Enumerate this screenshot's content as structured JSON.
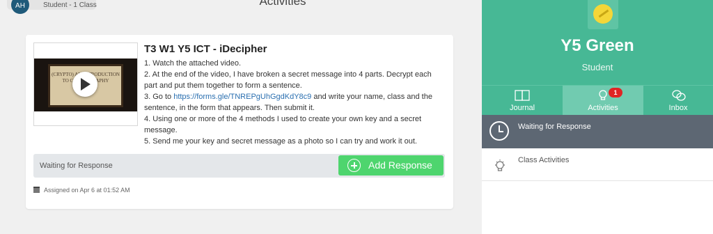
{
  "header": {
    "avatar_initials": "AH",
    "subtitle": "Student - 1 Class",
    "title": "Activities"
  },
  "activity": {
    "title": "T3 W1 Y5 ICT - iDecipher",
    "video_caption": "(CRYPTO) AN INTRODUCTION TO CRYPTOGRAPHY",
    "lines": {
      "l1": "1. Watch the attached video.",
      "l2": "2. At the end of the video, I have broken a secret message into 4 parts. Decrypt each part and put them together to form a sentence.",
      "l3_pre": "3. Go to ",
      "l3_link": "https://forms.gle/TNREPgUhGgdKdY8c9",
      "l3_post": " and write your name, class and the sentence, in the form that appears. Then submit it.",
      "l4": "4. Using one or more of the 4 methods I used to create your own key and a secret message.",
      "l5": "5. Send me your key and secret message as a photo so I can try and work it out."
    },
    "response_status": "Waiting for Response",
    "add_response_label": "Add Response",
    "assigned": "Assigned on Apr 6 at 01:52 AM"
  },
  "sidebar": {
    "class_name": "Y5 Green",
    "role": "Student",
    "tabs": {
      "journal": "Journal",
      "activities": "Activities",
      "activities_badge": "1",
      "inbox": "Inbox"
    },
    "filters": {
      "waiting": "Waiting for Response",
      "class_activities": "Class Activities"
    }
  },
  "colors": {
    "brand_green": "#47b895",
    "button_green": "#4ed56e",
    "badge_red": "#e02424",
    "selected_filter": "#5d6773",
    "link_blue": "#2a6fb0"
  }
}
